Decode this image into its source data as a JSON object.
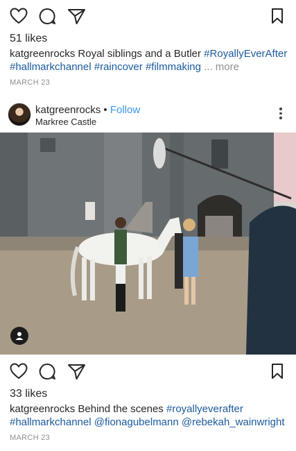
{
  "post1": {
    "likes": "51 likes",
    "caption_user": "katgreenrocks",
    "caption_text": "Royal siblings and a Butler",
    "caption_tag1": "#RoyallyEverAfter",
    "caption_tags_line2": "#hallmarkchannel #raincover #filmmaking",
    "more_label": "... more",
    "date": "MARCH 23"
  },
  "post2": {
    "header": {
      "username": "katgreenrocks",
      "separator": "•",
      "follow_label": "Follow",
      "location": "Markree Castle"
    },
    "likes": "33 likes",
    "caption_user": "katgreenrocks",
    "caption_text": "Behind the scenes",
    "caption_tag1": "#royallyeverafter",
    "caption_line2": "#hallmarkchannel  @fionagubelmann @rebekah_wainwright",
    "date": "MARCH 23"
  },
  "icons": [
    "heart-icon",
    "comment-icon",
    "share-icon",
    "bookmark-icon",
    "more-options-icon",
    "user-tag-icon"
  ]
}
